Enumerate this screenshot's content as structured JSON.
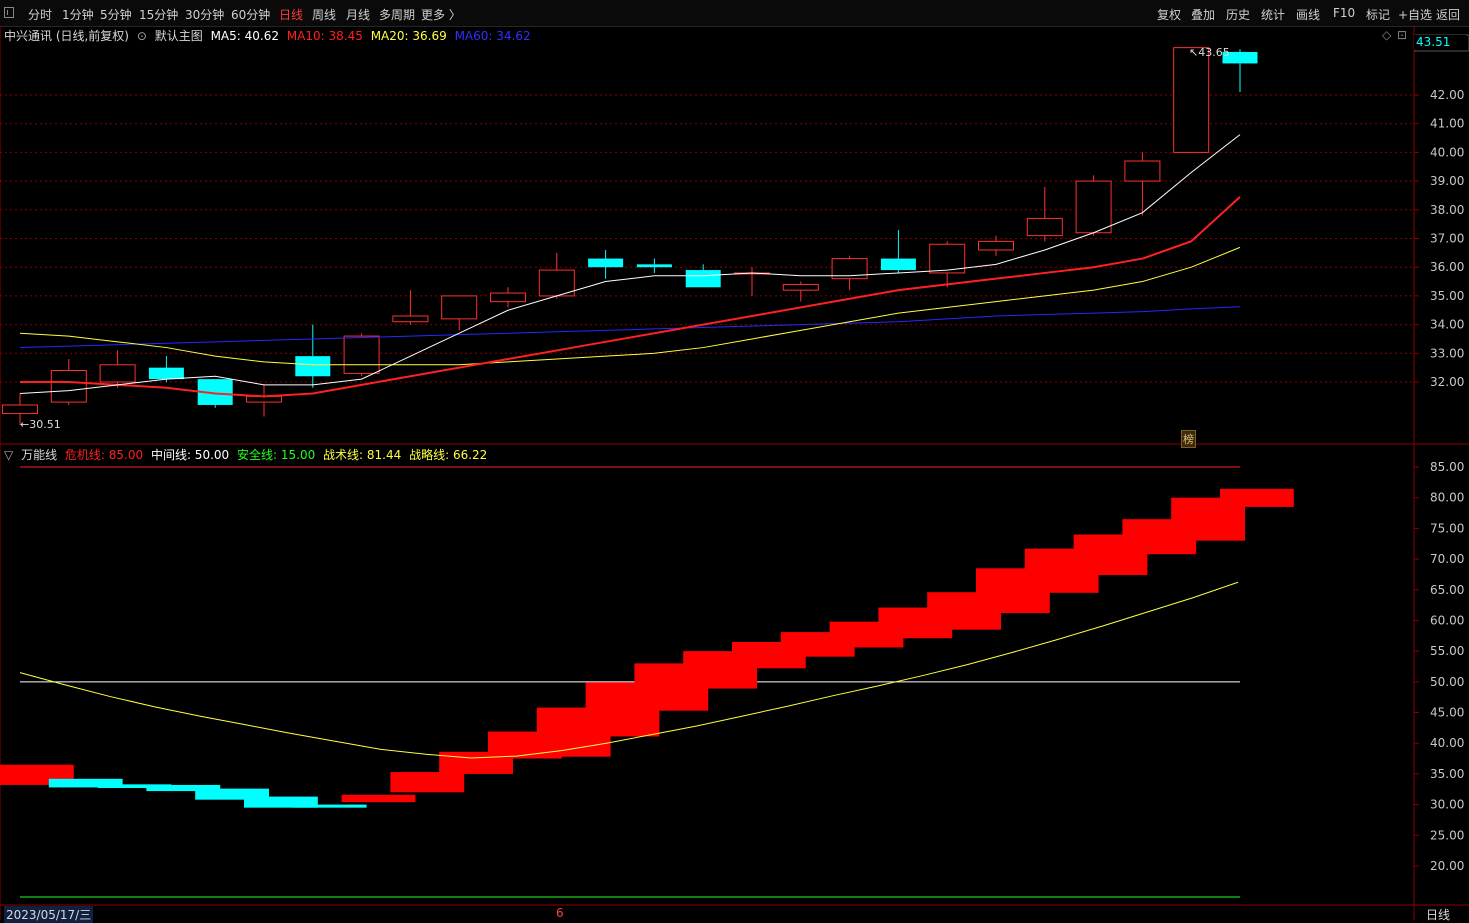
{
  "toolbar": {
    "periods": [
      "分时",
      "1分钟",
      "5分钟",
      "15分钟",
      "30分钟",
      "60分钟",
      "日线",
      "周线",
      "月线",
      "多周期",
      "更多 〉"
    ],
    "active_period": "日线",
    "right_buttons": [
      "复权",
      "叠加",
      "历史",
      "统计",
      "画线",
      "F10",
      "标记",
      "+自选",
      "返回"
    ]
  },
  "main_legend": {
    "title": "中兴通讯 (日线,前复权)",
    "template": "默认主图",
    "ma5": {
      "label": "MA5: 40.62",
      "color": "#ffffff"
    },
    "ma10": {
      "label": "MA10: 38.45",
      "color": "#ff2020"
    },
    "ma20": {
      "label": "MA20: 36.69",
      "color": "#ffff40"
    },
    "ma60": {
      "label": "MA60: 34.62",
      "color": "#3030ff"
    }
  },
  "current_price": "43.51",
  "high_marker": "43.65",
  "low_marker": "30.51",
  "marker_badge": "榜",
  "sub_legend": {
    "name": "万能线",
    "danger": {
      "label": "危机线: 85.00",
      "color": "#ff2020"
    },
    "middle": {
      "label": "中间线: 50.00",
      "color": "#ffffff"
    },
    "safety": {
      "label": "安全线: 15.00",
      "color": "#20ff20"
    },
    "tactic": {
      "label": "战术线: 81.44",
      "color": "#ffff40"
    },
    "strategy": {
      "label": "战略线: 66.22",
      "color": "#ffff40"
    }
  },
  "bottom": {
    "date": "2023/05/17/三",
    "month_mark": "6",
    "period": "日线"
  },
  "colors": {
    "up": "#ff3030",
    "down": "#00ffff",
    "grid": "#8b0000",
    "axis_text": "#c8c8c8"
  },
  "chart_data": {
    "type": "candlestick",
    "price_ticks": [
      "32.00",
      "33.00",
      "34.00",
      "35.00",
      "36.00",
      "37.00",
      "38.00",
      "39.00",
      "40.00",
      "41.00",
      "42.00"
    ],
    "indicator_ticks": [
      "20.00",
      "25.00",
      "30.00",
      "35.00",
      "40.00",
      "45.00",
      "50.00",
      "55.00",
      "60.00",
      "65.00",
      "70.00",
      "75.00",
      "80.00",
      "85.00"
    ],
    "candles": [
      {
        "o": 30.9,
        "h": 31.6,
        "l": 30.5,
        "c": 31.2
      },
      {
        "o": 31.3,
        "h": 32.8,
        "l": 31.2,
        "c": 32.4
      },
      {
        "o": 32.0,
        "h": 33.1,
        "l": 31.8,
        "c": 32.6
      },
      {
        "o": 32.5,
        "h": 32.9,
        "l": 32.0,
        "c": 32.1
      },
      {
        "o": 32.1,
        "h": 32.1,
        "l": 31.1,
        "c": 31.2
      },
      {
        "o": 31.3,
        "h": 31.9,
        "l": 30.8,
        "c": 31.5
      },
      {
        "o": 32.9,
        "h": 34.0,
        "l": 31.8,
        "c": 32.2
      },
      {
        "o": 32.3,
        "h": 33.7,
        "l": 32.2,
        "c": 33.6
      },
      {
        "o": 34.1,
        "h": 35.2,
        "l": 34.0,
        "c": 34.3
      },
      {
        "o": 34.2,
        "h": 35.0,
        "l": 33.8,
        "c": 35.0
      },
      {
        "o": 34.8,
        "h": 35.3,
        "l": 34.6,
        "c": 35.1
      },
      {
        "o": 35.0,
        "h": 36.5,
        "l": 34.9,
        "c": 35.9
      },
      {
        "o": 36.3,
        "h": 36.6,
        "l": 35.6,
        "c": 36.0
      },
      {
        "o": 36.1,
        "h": 36.3,
        "l": 35.8,
        "c": 36.0
      },
      {
        "o": 35.9,
        "h": 36.1,
        "l": 35.3,
        "c": 35.3
      },
      {
        "o": 35.8,
        "h": 36.0,
        "l": 35.0,
        "c": 35.8
      },
      {
        "o": 35.2,
        "h": 35.5,
        "l": 34.8,
        "c": 35.4
      },
      {
        "o": 35.6,
        "h": 36.4,
        "l": 35.2,
        "c": 36.3
      },
      {
        "o": 36.3,
        "h": 37.3,
        "l": 35.8,
        "c": 35.9
      },
      {
        "o": 35.8,
        "h": 36.9,
        "l": 35.3,
        "c": 36.8
      },
      {
        "o": 36.6,
        "h": 37.1,
        "l": 36.4,
        "c": 36.9
      },
      {
        "o": 37.1,
        "h": 38.8,
        "l": 36.9,
        "c": 37.7
      },
      {
        "o": 37.2,
        "h": 39.2,
        "l": 37.1,
        "c": 39.0
      },
      {
        "o": 39.0,
        "h": 40.0,
        "l": 37.8,
        "c": 39.7
      },
      {
        "o": 40.0,
        "h": 43.65,
        "l": 40.0,
        "c": 43.65
      },
      {
        "o": 43.5,
        "h": 43.6,
        "l": 42.1,
        "c": 43.1
      }
    ],
    "ma5": [
      31.6,
      31.7,
      31.9,
      32.1,
      32.2,
      31.9,
      31.9,
      32.1,
      32.9,
      33.7,
      34.5,
      35.0,
      35.5,
      35.7,
      35.7,
      35.8,
      35.7,
      35.7,
      35.8,
      35.9,
      36.1,
      36.6,
      37.2,
      37.9,
      39.3,
      40.62
    ],
    "ma10": [
      32.0,
      32.0,
      31.9,
      31.8,
      31.6,
      31.5,
      31.6,
      31.9,
      32.2,
      32.5,
      32.8,
      33.1,
      33.4,
      33.7,
      34.0,
      34.3,
      34.6,
      34.9,
      35.2,
      35.4,
      35.6,
      35.8,
      36.0,
      36.3,
      36.9,
      38.45
    ],
    "ma20": [
      33.7,
      33.6,
      33.4,
      33.2,
      32.9,
      32.7,
      32.6,
      32.6,
      32.6,
      32.6,
      32.7,
      32.8,
      32.9,
      33.0,
      33.2,
      33.5,
      33.8,
      34.1,
      34.4,
      34.6,
      34.8,
      35.0,
      35.2,
      35.5,
      36.0,
      36.69
    ],
    "ma60": [
      33.2,
      33.25,
      33.3,
      33.35,
      33.4,
      33.45,
      33.5,
      33.55,
      33.6,
      33.65,
      33.7,
      33.75,
      33.8,
      33.85,
      33.9,
      33.95,
      34.0,
      34.05,
      34.1,
      34.2,
      34.3,
      34.35,
      34.4,
      34.45,
      34.55,
      34.62
    ],
    "blocks": [
      {
        "top": 36.5,
        "bottom": 33.2
      },
      {
        "top": 34.2,
        "bottom": 32.8
      },
      {
        "top": 33.3,
        "bottom": 32.7
      },
      {
        "top": 33.2,
        "bottom": 32.2
      },
      {
        "top": 32.6,
        "bottom": 30.8
      },
      {
        "top": 31.3,
        "bottom": 29.5
      },
      {
        "top": 30.0,
        "bottom": 29.5
      },
      {
        "top": 31.6,
        "bottom": 30.4
      },
      {
        "top": 35.3,
        "bottom": 32.0
      },
      {
        "top": 38.6,
        "bottom": 35.0
      },
      {
        "top": 41.9,
        "bottom": 37.5
      },
      {
        "top": 45.8,
        "bottom": 37.8
      },
      {
        "top": 49.9,
        "bottom": 41.1
      },
      {
        "top": 53.0,
        "bottom": 45.3
      },
      {
        "top": 55.0,
        "bottom": 48.9
      },
      {
        "top": 56.5,
        "bottom": 52.2
      },
      {
        "top": 58.1,
        "bottom": 54.1
      },
      {
        "top": 59.8,
        "bottom": 55.6
      },
      {
        "top": 62.1,
        "bottom": 57.1
      },
      {
        "top": 64.6,
        "bottom": 58.5
      },
      {
        "top": 68.5,
        "bottom": 61.2
      },
      {
        "top": 71.7,
        "bottom": 64.5
      },
      {
        "top": 74.0,
        "bottom": 67.4
      },
      {
        "top": 76.5,
        "bottom": 70.8
      },
      {
        "top": 80.0,
        "bottom": 73.0
      },
      {
        "top": 81.44,
        "bottom": 78.5
      }
    ],
    "strategy": [
      51.5,
      49.5,
      47.6,
      45.9,
      44.4,
      43.0,
      41.6,
      40.3,
      39.0,
      38.2,
      37.6,
      37.9,
      38.8,
      40.0,
      41.4,
      42.8,
      44.4,
      46.0,
      47.7,
      49.3,
      51.0,
      52.8,
      54.8,
      56.9,
      59.1,
      61.4,
      63.7,
      66.22
    ],
    "danger": 85,
    "middle": 50,
    "safety": 15
  }
}
